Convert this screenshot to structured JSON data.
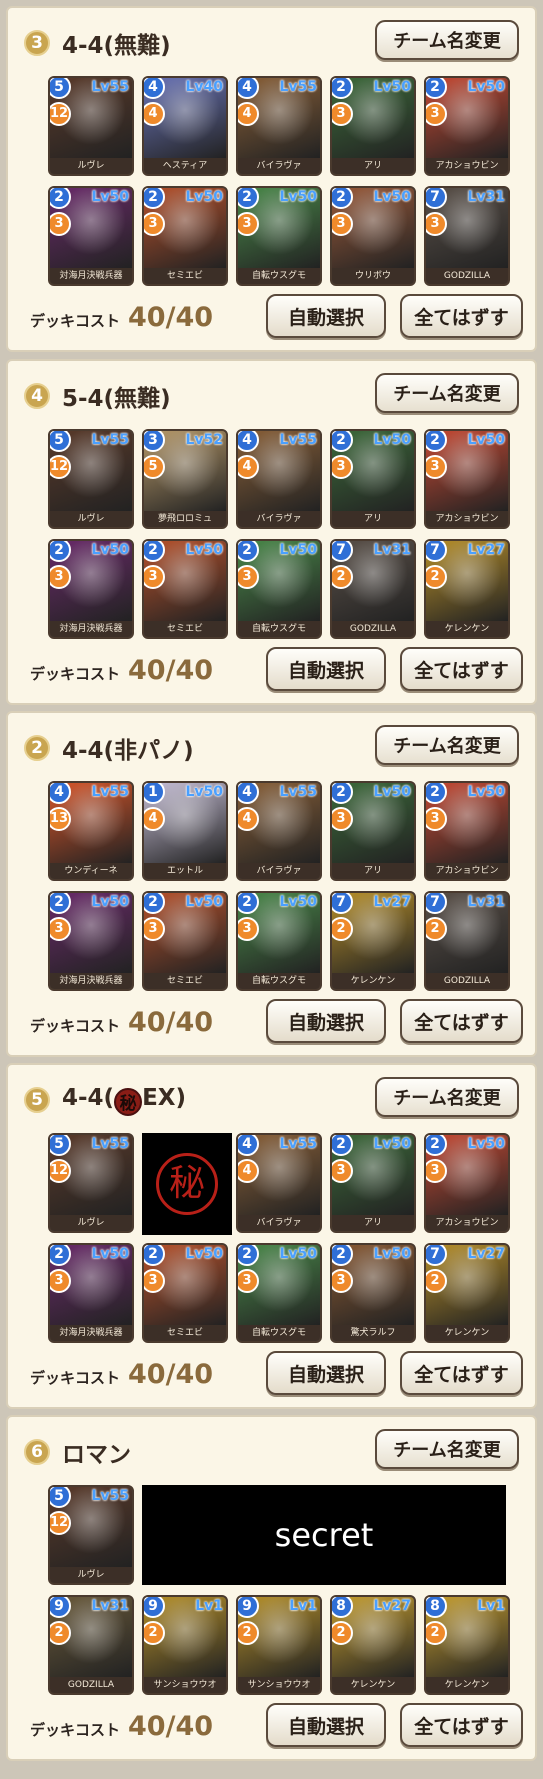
{
  "colors": {
    "panel_bg": "#fbf6e7",
    "number_badge": "#c9a550",
    "star_badge": "#2f6fd6",
    "cost_badge": "#ef8a2b",
    "level_text": "#4aa0ff"
  },
  "panels": [
    {
      "number": "3",
      "title": "4-4(無難)",
      "rename_label": "チーム名変更",
      "cost_label": "デッキコスト",
      "cost_value": "40/40",
      "auto_label": "自動選択",
      "clear_label": "全てはずす",
      "cards": [
        {
          "star": "5",
          "cost": "12",
          "level": "Lv55",
          "name": "ルヴレ",
          "color": "#5a3a2a"
        },
        {
          "star": "4",
          "cost": "4",
          "level": "Lv40",
          "name": "ヘスティア",
          "color": "#6a74b8"
        },
        {
          "star": "4",
          "cost": "4",
          "level": "Lv55",
          "name": "バイラヴァ",
          "color": "#8a6038"
        },
        {
          "star": "2",
          "cost": "3",
          "level": "Lv50",
          "name": "アリ",
          "color": "#3c6a3a"
        },
        {
          "star": "2",
          "cost": "3",
          "level": "Lv50",
          "name": "アカショウビン",
          "color": "#c84a34"
        },
        {
          "star": "2",
          "cost": "3",
          "level": "Lv50",
          "name": "対海月決戦兵器",
          "color": "#6a2a6a"
        },
        {
          "star": "2",
          "cost": "3",
          "level": "Lv50",
          "name": "セミエビ",
          "color": "#b8522c"
        },
        {
          "star": "2",
          "cost": "3",
          "level": "Lv50",
          "name": "自転ウスグモ",
          "color": "#4a8a4a"
        },
        {
          "star": "2",
          "cost": "3",
          "level": "Lv50",
          "name": "ウリボウ",
          "color": "#9a5a3a"
        },
        {
          "star": "7",
          "cost": "3",
          "level": "Lv31",
          "name": "GODZILLA",
          "color": "#5a5048"
        }
      ]
    },
    {
      "number": "4",
      "title": "5-4(無難)",
      "rename_label": "チーム名変更",
      "cost_label": "デッキコスト",
      "cost_value": "40/40",
      "auto_label": "自動選択",
      "clear_label": "全てはずす",
      "cards": [
        {
          "star": "5",
          "cost": "12",
          "level": "Lv55",
          "name": "ルヴレ",
          "color": "#5a3a2a"
        },
        {
          "star": "3",
          "cost": "5",
          "level": "Lv52",
          "name": "夢飛ロロミュ",
          "color": "#b89a6a"
        },
        {
          "star": "4",
          "cost": "4",
          "level": "Lv55",
          "name": "バイラヴァ",
          "color": "#8a6038"
        },
        {
          "star": "2",
          "cost": "3",
          "level": "Lv50",
          "name": "アリ",
          "color": "#3c6a3a"
        },
        {
          "star": "2",
          "cost": "3",
          "level": "Lv50",
          "name": "アカショウビン",
          "color": "#c84a34"
        },
        {
          "star": "2",
          "cost": "3",
          "level": "Lv50",
          "name": "対海月決戦兵器",
          "color": "#6a2a6a"
        },
        {
          "star": "2",
          "cost": "3",
          "level": "Lv50",
          "name": "セミエビ",
          "color": "#b8522c"
        },
        {
          "star": "2",
          "cost": "3",
          "level": "Lv50",
          "name": "自転ウスグモ",
          "color": "#4a8a4a"
        },
        {
          "star": "7",
          "cost": "2",
          "level": "Lv31",
          "name": "GODZILLA",
          "color": "#5a5048"
        },
        {
          "star": "7",
          "cost": "2",
          "level": "Lv27",
          "name": "ケレンケン",
          "color": "#b8902a"
        }
      ]
    },
    {
      "number": "2",
      "title": "4-4(非パノ)",
      "rename_label": "チーム名変更",
      "cost_label": "デッキコスト",
      "cost_value": "40/40",
      "auto_label": "自動選択",
      "clear_label": "全てはずす",
      "cards": [
        {
          "star": "4",
          "cost": "13",
          "level": "Lv55",
          "name": "ウンディーネ",
          "color": "#d8562a"
        },
        {
          "star": "1",
          "cost": "4",
          "level": "Lv50",
          "name": "エットル",
          "color": "#c8c0d8"
        },
        {
          "star": "4",
          "cost": "4",
          "level": "Lv55",
          "name": "バイラヴァ",
          "color": "#8a6038"
        },
        {
          "star": "2",
          "cost": "3",
          "level": "Lv50",
          "name": "アリ",
          "color": "#3c6a3a"
        },
        {
          "star": "2",
          "cost": "3",
          "level": "Lv50",
          "name": "アカショウビン",
          "color": "#c84a34"
        },
        {
          "star": "2",
          "cost": "3",
          "level": "Lv50",
          "name": "対海月決戦兵器",
          "color": "#6a2a6a"
        },
        {
          "star": "2",
          "cost": "3",
          "level": "Lv50",
          "name": "セミエビ",
          "color": "#b8522c"
        },
        {
          "star": "2",
          "cost": "3",
          "level": "Lv50",
          "name": "自転ウスグモ",
          "color": "#4a8a4a"
        },
        {
          "star": "7",
          "cost": "2",
          "level": "Lv27",
          "name": "ケレンケン",
          "color": "#b8902a"
        },
        {
          "star": "7",
          "cost": "2",
          "level": "Lv31",
          "name": "GODZILLA",
          "color": "#5a5048"
        }
      ]
    },
    {
      "number": "5",
      "title_before": "4-4(",
      "secret_char": "秘",
      "title_after": "EX)",
      "rename_label": "チーム名変更",
      "cost_label": "デッキコスト",
      "cost_value": "40/40",
      "auto_label": "自動選択",
      "clear_label": "全てはずす",
      "locked_char": "秘",
      "cards": [
        {
          "star": "5",
          "cost": "12",
          "level": "Lv55",
          "name": "ルヴレ",
          "color": "#5a3a2a"
        },
        {
          "locked": true
        },
        {
          "star": "4",
          "cost": "4",
          "level": "Lv55",
          "name": "バイラヴァ",
          "color": "#8a6038"
        },
        {
          "star": "2",
          "cost": "3",
          "level": "Lv50",
          "name": "アリ",
          "color": "#3c6a3a"
        },
        {
          "star": "2",
          "cost": "3",
          "level": "Lv50",
          "name": "アカショウビン",
          "color": "#c84a34"
        },
        {
          "star": "2",
          "cost": "3",
          "level": "Lv50",
          "name": "対海月決戦兵器",
          "color": "#6a2a6a"
        },
        {
          "star": "2",
          "cost": "3",
          "level": "Lv50",
          "name": "セミエビ",
          "color": "#b8522c"
        },
        {
          "star": "2",
          "cost": "3",
          "level": "Lv50",
          "name": "自転ウスグモ",
          "color": "#4a8a4a"
        },
        {
          "star": "2",
          "cost": "3",
          "level": "Lv50",
          "name": "驚犬ラルフ",
          "color": "#8a5a34"
        },
        {
          "star": "7",
          "cost": "2",
          "level": "Lv27",
          "name": "ケレンケン",
          "color": "#b8902a"
        }
      ]
    },
    {
      "number": "6",
      "title": "ロマン",
      "rename_label": "チーム名変更",
      "cost_label": "デッキコスト",
      "cost_value": "40/40",
      "auto_label": "自動選択",
      "clear_label": "全てはずす",
      "secret_text": "secret",
      "cards": [
        {
          "star": "5",
          "cost": "12",
          "level": "Lv55",
          "name": "ルヴレ",
          "color": "#5a3a2a"
        },
        {
          "hidden": true
        },
        {
          "hidden": true
        },
        {
          "hidden": true
        },
        {
          "hidden": true
        },
        {
          "star": "9",
          "cost": "2",
          "level": "Lv31",
          "name": "GODZILLA",
          "color": "#6a5a3a"
        },
        {
          "star": "9",
          "cost": "2",
          "level": "Lv1",
          "name": "サンショウウオ",
          "color": "#b8922a"
        },
        {
          "star": "9",
          "cost": "2",
          "level": "Lv1",
          "name": "サンショウウオ",
          "color": "#b8922a"
        },
        {
          "star": "8",
          "cost": "2",
          "level": "Lv27",
          "name": "ケレンケン",
          "color": "#c8a030"
        },
        {
          "star": "8",
          "cost": "2",
          "level": "Lv1",
          "name": "ケレンケン",
          "color": "#c8a030"
        }
      ]
    }
  ]
}
